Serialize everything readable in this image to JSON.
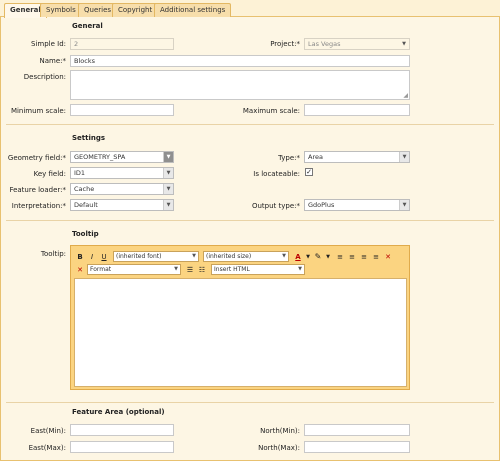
{
  "tabs": [
    {
      "label": "General"
    },
    {
      "label": "Symbols"
    },
    {
      "label": "Queries"
    },
    {
      "label": "Copyright"
    },
    {
      "label": "Additional settings"
    }
  ],
  "general": {
    "title": "General",
    "simple_id_label": "Simple Id:",
    "simple_id_value": "2",
    "project_label": "Project:*",
    "project_value": "Las Vegas",
    "name_label": "Name:*",
    "name_value": "Blocks",
    "description_label": "Description:",
    "description_value": "",
    "min_scale_label": "Minimum scale:",
    "min_scale_value": "",
    "max_scale_label": "Maximum scale:",
    "max_scale_value": ""
  },
  "settings": {
    "title": "Settings",
    "geometry_label": "Geometry field:*",
    "geometry_value": "GEOMETRY_SPA",
    "type_label": "Type:*",
    "type_value": "Area",
    "key_label": "Key field:",
    "key_value": "ID1",
    "locateable_label": "Is locateable:",
    "locateable_checked": true,
    "loader_label": "Feature loader:*",
    "loader_value": "Cache",
    "interp_label": "Interpretation:*",
    "interp_value": "Default",
    "output_label": "Output type:*",
    "output_value": "GdoPlus"
  },
  "tooltip": {
    "title": "Tooltip",
    "label": "Tooltip:",
    "font_select": "(inherited font)",
    "size_select": "(inherited size)",
    "format_select": "Format",
    "insert_select": "Insert HTML",
    "bold": "B",
    "italic": "I",
    "underline": "U"
  },
  "feature_area": {
    "title": "Feature Area (optional)",
    "east_min_label": "East(Min):",
    "north_min_label": "North(Min):",
    "east_max_label": "East(Max):",
    "north_max_label": "North(Max):",
    "east_min_value": "",
    "north_min_value": "",
    "east_max_value": "",
    "north_max_value": ""
  },
  "colors": {
    "tab_active": "#fff8ea",
    "editor_toolbar": "#fbd481",
    "panel_bg": "#fdf6e4"
  }
}
